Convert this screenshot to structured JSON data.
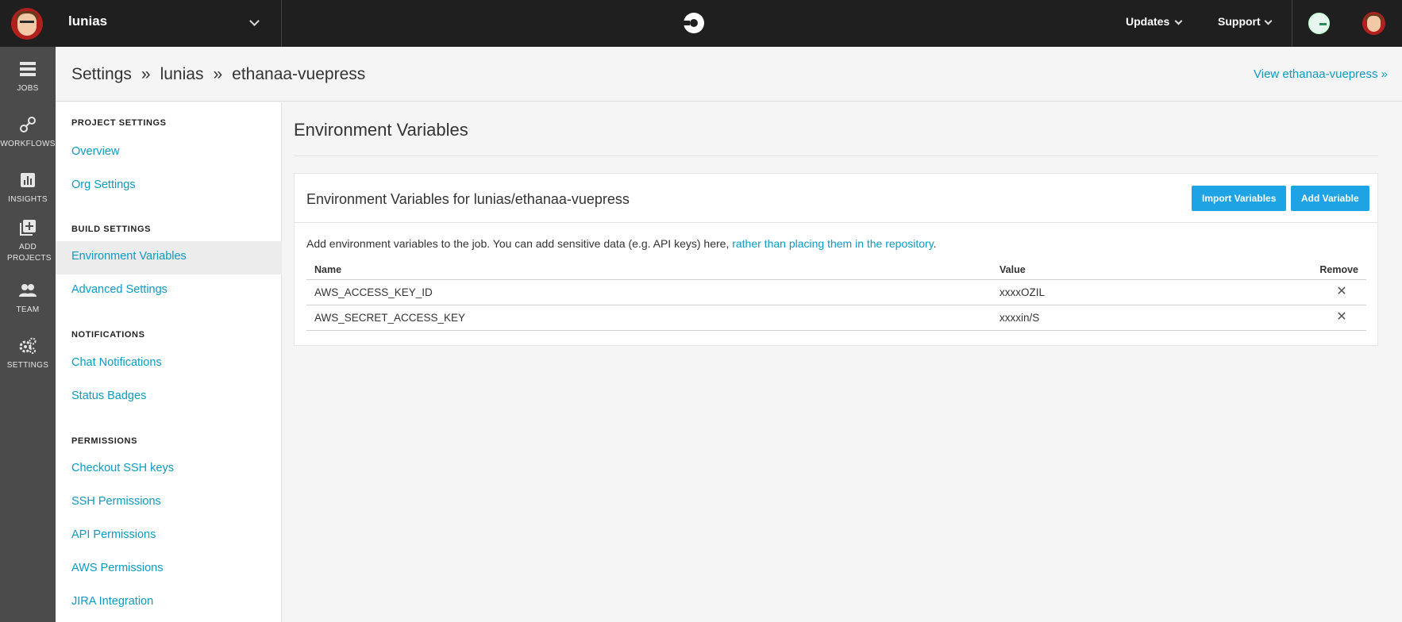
{
  "topbar": {
    "org_name": "lunias",
    "updates_label": "Updates",
    "support_label": "Support"
  },
  "rail": {
    "items": [
      {
        "label": "JOBS",
        "icon": "jobs-icon"
      },
      {
        "label": "WORKFLOWS",
        "icon": "workflows-icon"
      },
      {
        "label": "INSIGHTS",
        "icon": "insights-icon"
      },
      {
        "label": "ADD PROJECTS",
        "icon": "add-projects-icon"
      },
      {
        "label": "TEAM",
        "icon": "team-icon"
      },
      {
        "label": "SETTINGS",
        "icon": "settings-icon"
      }
    ]
  },
  "breadcrumb": {
    "items": [
      "Settings",
      "lunias",
      "ethanaa-vuepress"
    ],
    "separator": "»"
  },
  "view_link": "View ethanaa-vuepress »",
  "settings_nav": {
    "sections": [
      {
        "heading": "PROJECT SETTINGS",
        "links": [
          "Overview",
          "Org Settings"
        ]
      },
      {
        "heading": "BUILD SETTINGS",
        "links": [
          "Environment Variables",
          "Advanced Settings"
        ]
      },
      {
        "heading": "NOTIFICATIONS",
        "links": [
          "Chat Notifications",
          "Status Badges"
        ]
      },
      {
        "heading": "PERMISSIONS",
        "links": [
          "Checkout SSH keys",
          "SSH Permissions",
          "API Permissions",
          "AWS Permissions",
          "JIRA Integration"
        ]
      }
    ],
    "active": "Environment Variables"
  },
  "main": {
    "title": "Environment Variables",
    "card_title": "Environment Variables for lunias/ethanaa-vuepress",
    "import_button": "Import Variables",
    "add_button": "Add Variable",
    "desc_text": "Add environment variables to the job. You can add sensitive data (e.g. API keys) here, ",
    "desc_link": "rather than placing them in the repository",
    "desc_end": ".",
    "columns": [
      "Name",
      "Value",
      "Remove"
    ],
    "rows": [
      {
        "name": "AWS_ACCESS_KEY_ID",
        "value": "xxxxOZIL"
      },
      {
        "name": "AWS_SECRET_ACCESS_KEY",
        "value": "xxxxin/S"
      }
    ]
  },
  "colors": {
    "topbar": "#1f1f1f",
    "rail": "#4b4b4b",
    "link": "#0a9bc4",
    "button": "#1ea4e4"
  }
}
